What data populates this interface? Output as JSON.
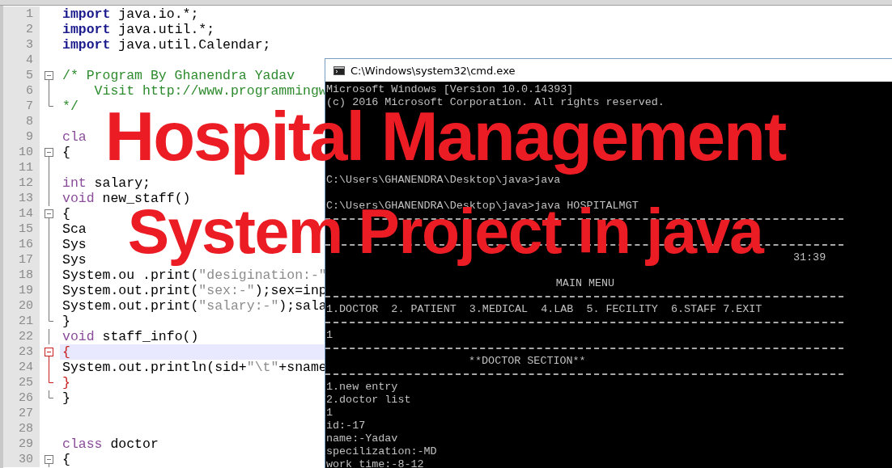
{
  "editor": {
    "lines": [
      {
        "number": "1",
        "kind": "plain",
        "current": false,
        "segments": [
          {
            "kind": "keyword",
            "text": "import"
          },
          {
            "kind": "plain",
            "text": " java.io.*;"
          }
        ]
      },
      {
        "number": "2",
        "kind": "plain",
        "current": false,
        "segments": [
          {
            "kind": "keyword",
            "text": "import"
          },
          {
            "kind": "plain",
            "text": " java.util.*;"
          }
        ]
      },
      {
        "number": "3",
        "kind": "plain",
        "current": false,
        "segments": [
          {
            "kind": "keyword",
            "text": "import"
          },
          {
            "kind": "plain",
            "text": " java.util.Calendar;"
          }
        ]
      },
      {
        "number": "4",
        "kind": "plain",
        "current": false
      },
      {
        "number": "5",
        "kind": "fold-start",
        "current": false,
        "segments": [
          {
            "kind": "comment",
            "text": "/* Program By Ghanendra Yadav"
          }
        ]
      },
      {
        "number": "6",
        "kind": "fold-mid",
        "current": false,
        "segments": [
          {
            "kind": "comment",
            "text": "    Visit http://www.programmingw"
          }
        ]
      },
      {
        "number": "7",
        "kind": "fold-end",
        "current": false,
        "segments": [
          {
            "kind": "comment",
            "text": "*/"
          }
        ]
      },
      {
        "number": "8",
        "kind": "plain",
        "current": false
      },
      {
        "number": "9",
        "kind": "plain",
        "current": false,
        "segments": [
          {
            "kind": "type",
            "text": "cla"
          }
        ]
      },
      {
        "number": "10",
        "kind": "fold-start",
        "current": false,
        "segments": [
          {
            "kind": "plain",
            "text": "{"
          }
        ]
      },
      {
        "number": "11",
        "kind": "fold-mid",
        "current": false
      },
      {
        "number": "12",
        "kind": "fold-mid",
        "current": false,
        "segments": [
          {
            "kind": "type",
            "text": "int"
          },
          {
            "kind": "plain",
            "text": " salary;"
          }
        ]
      },
      {
        "number": "13",
        "kind": "fold-mid",
        "current": false,
        "segments": [
          {
            "kind": "type",
            "text": "void"
          },
          {
            "kind": "plain",
            "text": " new_staff()"
          }
        ]
      },
      {
        "number": "14",
        "kind": "fold-start",
        "current": false,
        "segments": [
          {
            "kind": "plain",
            "text": "{"
          }
        ]
      },
      {
        "number": "15",
        "kind": "fold-mid",
        "current": false,
        "segments": [
          {
            "kind": "plain",
            "text": "Sca"
          }
        ]
      },
      {
        "number": "16",
        "kind": "fold-mid",
        "current": false,
        "segments": [
          {
            "kind": "plain",
            "text": "Sys"
          }
        ]
      },
      {
        "number": "17",
        "kind": "fold-mid",
        "current": false,
        "segments": [
          {
            "kind": "plain",
            "text": "Sys"
          }
        ]
      },
      {
        "number": "18",
        "kind": "fold-mid",
        "current": false,
        "segments": [
          {
            "kind": "plain",
            "text": "System.ou .print("
          },
          {
            "kind": "string",
            "text": "\"desigination:-\""
          }
        ]
      },
      {
        "number": "19",
        "kind": "fold-mid",
        "current": false,
        "segments": [
          {
            "kind": "plain",
            "text": "System.out.print("
          },
          {
            "kind": "string",
            "text": "\"sex:-\""
          },
          {
            "kind": "plain",
            "text": ");sex=inp"
          }
        ]
      },
      {
        "number": "20",
        "kind": "fold-mid",
        "current": false,
        "segments": [
          {
            "kind": "plain",
            "text": "System.out.print("
          },
          {
            "kind": "string",
            "text": "\"salary:-\""
          },
          {
            "kind": "plain",
            "text": ");sala"
          }
        ]
      },
      {
        "number": "21",
        "kind": "fold-end",
        "current": false,
        "segments": [
          {
            "kind": "plain",
            "text": "}"
          }
        ]
      },
      {
        "number": "22",
        "kind": "fold-mid",
        "current": false,
        "segments": [
          {
            "kind": "type",
            "text": "void"
          },
          {
            "kind": "plain",
            "text": " staff_info()"
          }
        ]
      },
      {
        "number": "23",
        "kind": "fold-start-active",
        "current": true,
        "segments": [
          {
            "kind": "brace",
            "text": "{"
          }
        ]
      },
      {
        "number": "24",
        "kind": "fold-mid-active",
        "current": false,
        "segments": [
          {
            "kind": "plain",
            "text": "System.out.println(sid+"
          },
          {
            "kind": "string",
            "text": "\"\\t\""
          },
          {
            "kind": "plain",
            "text": "+sname"
          }
        ]
      },
      {
        "number": "25",
        "kind": "fold-end-active",
        "current": false,
        "segments": [
          {
            "kind": "brace",
            "text": "}"
          }
        ]
      },
      {
        "number": "26",
        "kind": "fold-end",
        "current": false,
        "segments": [
          {
            "kind": "plain",
            "text": "}"
          }
        ]
      },
      {
        "number": "27",
        "kind": "plain",
        "current": false
      },
      {
        "number": "28",
        "kind": "plain",
        "current": false
      },
      {
        "number": "29",
        "kind": "plain",
        "current": false,
        "segments": [
          {
            "kind": "type",
            "text": "class"
          },
          {
            "kind": "plain",
            "text": " doctor"
          }
        ]
      },
      {
        "number": "30",
        "kind": "fold-start",
        "current": false,
        "segments": [
          {
            "kind": "plain",
            "text": "{"
          }
        ]
      }
    ]
  },
  "console": {
    "title": "C:\\Windows\\system32\\cmd.exe",
    "lines": [
      {
        "kind": "text",
        "text": "Microsoft Windows [Version 10.0.14393]"
      },
      {
        "kind": "text",
        "text": "(c) 2016 Microsoft Corporation. All rights reserved."
      },
      {
        "kind": "blank"
      },
      {
        "kind": "blank"
      },
      {
        "kind": "blank"
      },
      {
        "kind": "blank"
      },
      {
        "kind": "blank"
      },
      {
        "kind": "text",
        "text": "C:\\Users\\GHANENDRA\\Desktop\\java>java"
      },
      {
        "kind": "blank"
      },
      {
        "kind": "text",
        "text": "C:\\Users\\GHANENDRA\\Desktop\\java>java HOSPITALMGT"
      },
      {
        "kind": "rule"
      },
      {
        "kind": "blank"
      },
      {
        "kind": "rule"
      },
      {
        "kind": "time",
        "text": "31:39"
      },
      {
        "kind": "blank"
      },
      {
        "kind": "center",
        "text": "MAIN MENU"
      },
      {
        "kind": "rule"
      },
      {
        "kind": "text",
        "text": "1.DOCTOR  2. PATIENT  3.MEDICAL  4.LAB  5. FECILITY  6.STAFF 7.EXIT"
      },
      {
        "kind": "rule"
      },
      {
        "kind": "text",
        "text": "1"
      },
      {
        "kind": "rule"
      },
      {
        "kind": "section",
        "text": "**DOCTOR SECTION**"
      },
      {
        "kind": "rule"
      },
      {
        "kind": "text",
        "text": "1.new entry"
      },
      {
        "kind": "text",
        "text": "2.doctor list"
      },
      {
        "kind": "text",
        "text": "1"
      },
      {
        "kind": "text",
        "text": "id:-17"
      },
      {
        "kind": "text",
        "text": "name:-Yadav"
      },
      {
        "kind": "text",
        "text": "specilization:-MD"
      },
      {
        "kind": "text",
        "text": "work time:-8-12"
      }
    ]
  },
  "title_overlay": [
    "Hospital Management",
    "System Project in java"
  ]
}
